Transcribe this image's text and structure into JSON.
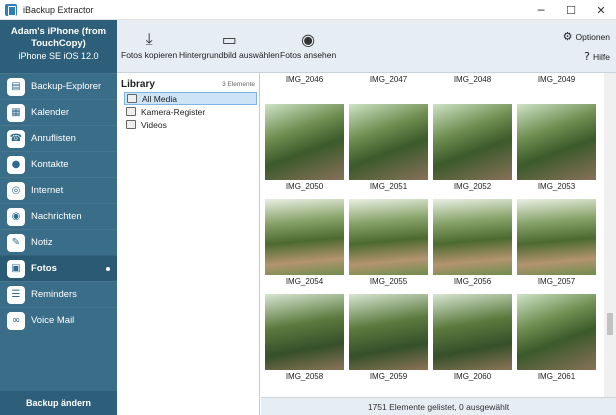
{
  "window": {
    "title": "iBackup Extractor"
  },
  "device": {
    "name": "Adam's iPhone (from TouchCopy)",
    "os": "iPhone SE iOS 12.0"
  },
  "nav": [
    {
      "label": "Backup-Explorer",
      "icon": "folder-icon",
      "active": false
    },
    {
      "label": "Kalender",
      "icon": "calendar-icon",
      "active": false
    },
    {
      "label": "Anruflisten",
      "icon": "phone-icon",
      "active": false
    },
    {
      "label": "Kontakte",
      "icon": "contacts-icon",
      "active": false
    },
    {
      "label": "Internet",
      "icon": "globe-icon",
      "active": false
    },
    {
      "label": "Nachrichten",
      "icon": "message-icon",
      "active": false
    },
    {
      "label": "Notiz",
      "icon": "pencil-icon",
      "active": false
    },
    {
      "label": "Fotos",
      "icon": "photos-icon",
      "active": true
    },
    {
      "label": "Reminders",
      "icon": "list-icon",
      "active": false
    },
    {
      "label": "Voice Mail",
      "icon": "voicemail-icon",
      "active": false
    }
  ],
  "backup_change_label": "Backup ändern",
  "toolbar": {
    "copy_photos": "Fotos kopieren",
    "wallpaper": "Hintergrundbild auswählen",
    "view_photos": "Fotos ansehen",
    "options": "Optionen",
    "help": "Hilfe"
  },
  "library": {
    "title": "Library",
    "count": "3 Elemente",
    "items": [
      {
        "label": "All Media",
        "selected": true
      },
      {
        "label": "Kamera-Register",
        "selected": false
      },
      {
        "label": "Videos",
        "selected": false
      }
    ]
  },
  "photos": {
    "rows": [
      [
        "IMG_2046",
        "IMG_2047",
        "IMG_2048",
        "IMG_2049"
      ],
      [
        "IMG_2050",
        "IMG_2051",
        "IMG_2052",
        "IMG_2053"
      ],
      [
        "IMG_2054",
        "IMG_2055",
        "IMG_2056",
        "IMG_2057"
      ],
      [
        "IMG_2058",
        "IMG_2059",
        "IMG_2060",
        "IMG_2061"
      ]
    ]
  },
  "status": "1751 Elemente gelistet, 0 ausgewählt"
}
